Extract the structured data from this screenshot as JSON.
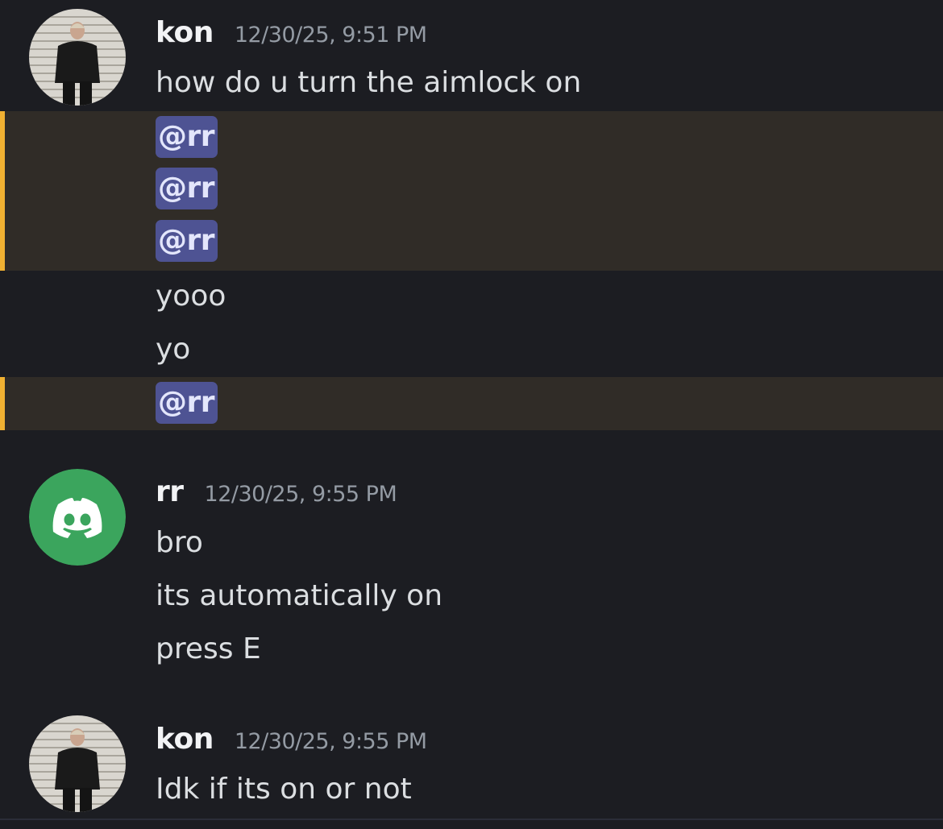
{
  "messages": [
    {
      "author": "kon",
      "timestamp": "12/30/25, 9:51 PM",
      "lines": [
        "how do u turn the aimlock on",
        "@rr",
        "@rr",
        "@rr",
        "yooo",
        "yo",
        "@rr"
      ]
    },
    {
      "author": "rr",
      "timestamp": "12/30/25, 9:55 PM",
      "lines": [
        "bro",
        "its automatically on",
        "press E"
      ]
    },
    {
      "author": "kon",
      "timestamp": "12/30/25, 9:55 PM",
      "lines": [
        "Idk if its on or not"
      ]
    }
  ],
  "colors": {
    "background": "#1c1d22",
    "mention_highlight": "#302c27",
    "mention_bar": "#f0b132",
    "mention_pill": "#4e5393",
    "discord_green": "#3ba55d"
  },
  "icons": {
    "kon_avatar": "user-photo-avatar",
    "rr_avatar": "discord-logo-icon"
  }
}
